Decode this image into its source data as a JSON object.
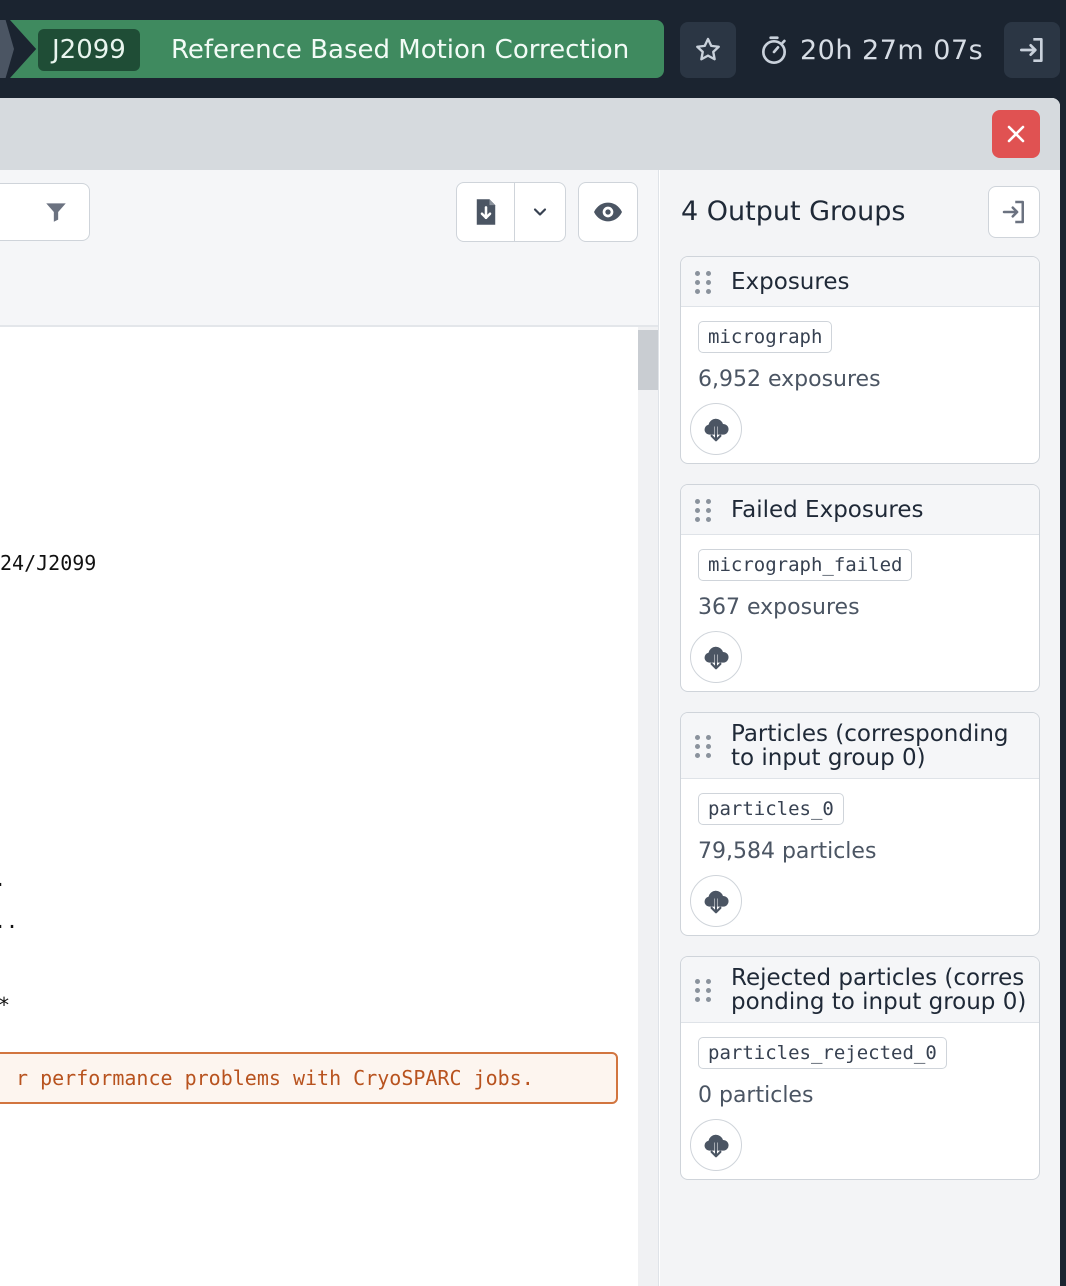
{
  "topbar": {
    "job_id": "J2099",
    "job_title": "Reference Based Motion Correction",
    "timer": "20h 27m 07s",
    "icons": {
      "star": "star-icon",
      "timer": "stopwatch-icon",
      "exit": "exit-icon"
    },
    "colors": {
      "pill": "#3f8a5f",
      "pill_id": "#1f4d36",
      "bar": "#1b2430"
    }
  },
  "window": {
    "close_icon": "close-icon",
    "close_color": "#e05252"
  },
  "log": {
    "lines": [
      "24/J2099",
      ".",
      "..",
      "*"
    ],
    "warning": "r performance problems with CryoSPARC jobs.",
    "warning_color": "#b8531f",
    "toolbar_icons": {
      "filter": "filter-icon",
      "download": "download-file-icon",
      "caret": "chevron-down-icon",
      "view": "eye-icon"
    }
  },
  "outputs": {
    "title": "4 Output Groups",
    "groups": [
      {
        "name": "Exposures",
        "tag": "micrograph",
        "count": "6,952 exposures"
      },
      {
        "name": "Failed Exposures",
        "tag": "micrograph_failed",
        "count": "367 exposures"
      },
      {
        "name_line1": "Particles (corresponding",
        "name_line2": "to input group 0)",
        "tag": "particles_0",
        "count": "79,584 particles"
      },
      {
        "name_line1": "Rejected particles (corres",
        "name_line2": "ponding to input group 0)",
        "tag": "particles_rejected_0",
        "count": "0 particles"
      }
    ]
  }
}
